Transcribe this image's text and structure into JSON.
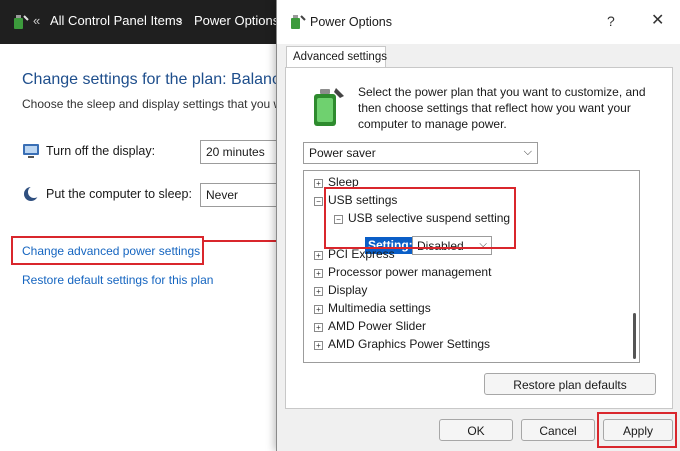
{
  "control_panel": {
    "breadcrumb_1": "All Control Panel Items",
    "breadcrumb_2": "Power Options",
    "heading": "Change settings for the plan: Balance",
    "subheading": "Choose the sleep and display settings that you w",
    "display_label": "Turn off the display:",
    "display_value": "20 minutes",
    "sleep_label": "Put the computer to sleep:",
    "sleep_value": "Never",
    "advanced_link": "Change advanced power settings",
    "restore_link": "Restore default settings for this plan"
  },
  "dialog": {
    "title": "Power Options",
    "help": "?",
    "close": "✕",
    "tab": "Advanced settings",
    "description": "Select the power plan that you want to customize, and then choose settings that reflect how you want your computer to manage power.",
    "plan": "Power saver",
    "tree": {
      "sleep": "Sleep",
      "usb": "USB settings",
      "usb_suspend": "USB selective suspend setting",
      "setting_label": "Setting:",
      "setting_value": "Disabled",
      "pci": "PCI Express",
      "processor": "Processor power management",
      "display": "Display",
      "multimedia": "Multimedia settings",
      "amd_slider": "AMD Power Slider",
      "amd_graphics": "AMD Graphics Power Settings"
    },
    "restore_button": "Restore plan defaults",
    "ok": "OK",
    "cancel": "Cancel",
    "apply": "Apply"
  },
  "colors": {
    "highlight": "#d9262c",
    "link": "#1565c0",
    "heading": "#1e4e8c",
    "selection": "#0a5ec7"
  },
  "icons": [
    "power-options-icon",
    "display-icon",
    "sleep-moon-icon",
    "battery-plan-icon",
    "chevron-down-icon",
    "expand-plus-icon",
    "collapse-minus-icon",
    "help-icon",
    "close-icon"
  ]
}
